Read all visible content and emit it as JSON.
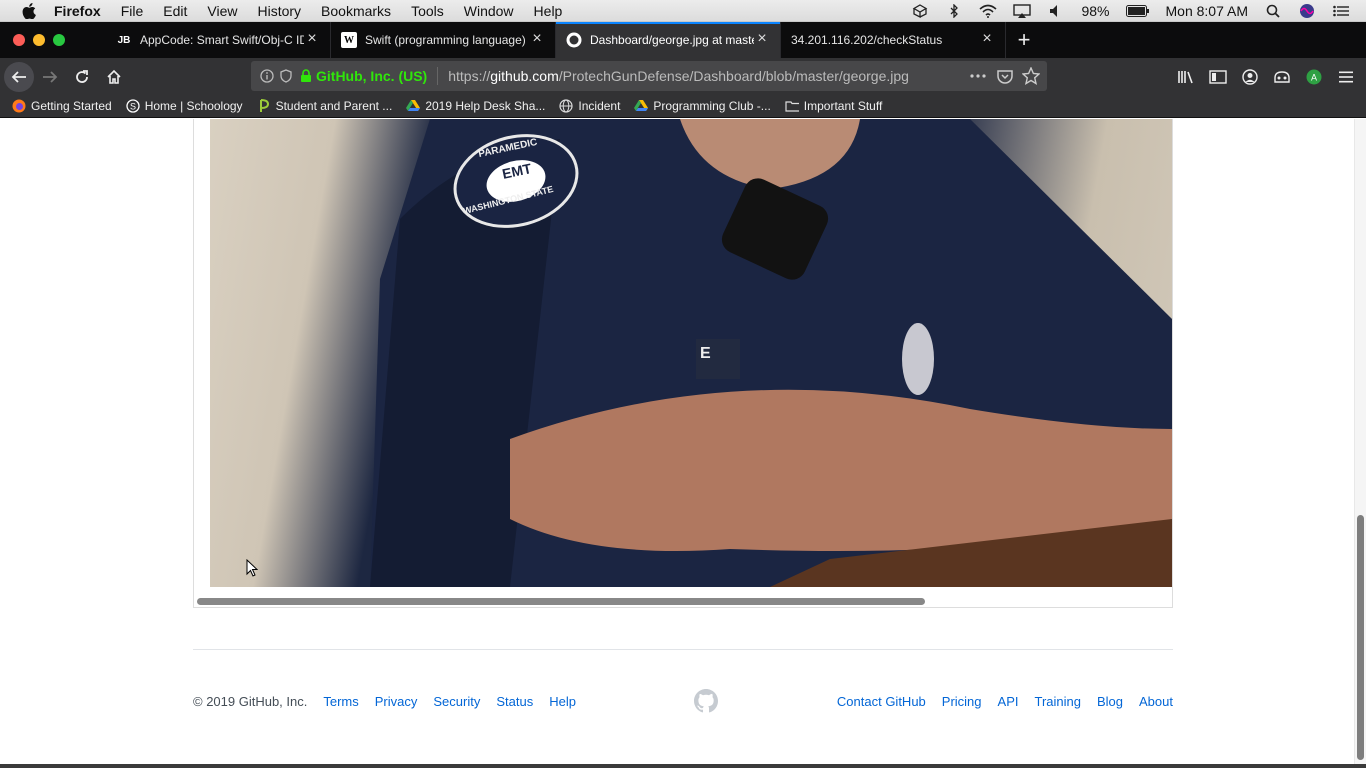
{
  "menubar": {
    "app_name": "Firefox",
    "items": [
      "File",
      "Edit",
      "View",
      "History",
      "Bookmarks",
      "Tools",
      "Window",
      "Help"
    ],
    "battery": "98%",
    "clock": "Mon 8:07 AM"
  },
  "tabs": [
    {
      "favicon_text": "JB",
      "title": "AppCode: Smart Swift/Obj-C ID",
      "active": false
    },
    {
      "favicon_text": "W",
      "title": "Swift (programming language) -",
      "active": false
    },
    {
      "favicon_text": "",
      "title": "Dashboard/george.jpg at maste",
      "active": true
    },
    {
      "favicon_text": "",
      "title": "34.201.116.202/checkStatus",
      "active": false
    }
  ],
  "urlbar": {
    "identity": "GitHub, Inc. (US)",
    "scheme": "https://",
    "host": "github.com",
    "path": "/ProtechGunDefense/Dashboard/blob/master/george.jpg"
  },
  "bookmarks": [
    "Getting Started",
    "Home | Schoology",
    "Student and Parent ...",
    "2019 Help Desk Sha...",
    "Incident",
    "Programming Club -...",
    "Important Stuff"
  ],
  "photo": {
    "patch_top": "PARAMEDIC",
    "patch_center": "EMT",
    "patch_bottom": "WASHINGTON STATE",
    "sleeve_letter": "E"
  },
  "footer": {
    "copyright": "© 2019 GitHub, Inc.",
    "left_links": [
      "Terms",
      "Privacy",
      "Security",
      "Status",
      "Help"
    ],
    "right_links": [
      "Contact GitHub",
      "Pricing",
      "API",
      "Training",
      "Blog",
      "About"
    ]
  },
  "colors": {
    "tab_bg": "#0c0c0d",
    "toolbar_bg": "#323234",
    "secure_green": "#30e60b",
    "link_blue": "#0366d6",
    "uniform_navy": "#1a2440"
  }
}
